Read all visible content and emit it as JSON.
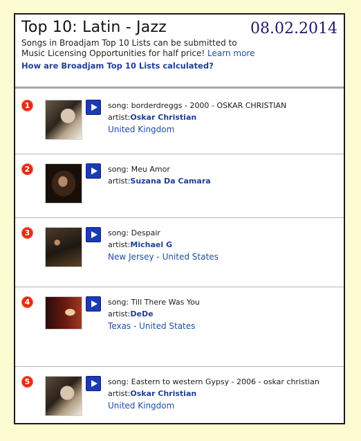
{
  "header": {
    "title": "Top 10: Latin - Jazz",
    "date": "08.02.2014",
    "intro_text": "Songs in Broadjam Top 10 Lists can be submitted to Music Licensing Opportunities for half price!",
    "learn_more": "Learn more",
    "calc_link": "How are Broadjam Top 10 Lists calculated?"
  },
  "labels": {
    "song": "song:",
    "artist": "artist:"
  },
  "entries": [
    {
      "rank": "1",
      "song": "borderdreggs - 2000 - OSKAR CHRISTIAN",
      "artist": "Oskar Christian",
      "region": "",
      "country": "United Kingdom"
    },
    {
      "rank": "2",
      "song": "Meu Amor",
      "artist": "Suzana Da Camara",
      "region": "",
      "country": ""
    },
    {
      "rank": "3",
      "song": "Despair",
      "artist": "Michael G",
      "region": "New Jersey",
      "country": "United States"
    },
    {
      "rank": "4",
      "song": "Till There Was You",
      "artist": "DeDe",
      "region": "Texas",
      "country": "United States"
    },
    {
      "rank": "5",
      "song": "Eastern to western Gypsy - 2006 - oskar christian",
      "artist": "Oskar Christian",
      "region": "",
      "country": "United Kingdom"
    }
  ],
  "colors": {
    "page_bg": "#fdfbd2",
    "rank_badge": "#e32b13",
    "play_button": "#1b3ab8",
    "link": "#1f4ea3",
    "date": "#1c1a66"
  },
  "icons": {
    "play": "play-icon",
    "rank": "rank-badge"
  }
}
